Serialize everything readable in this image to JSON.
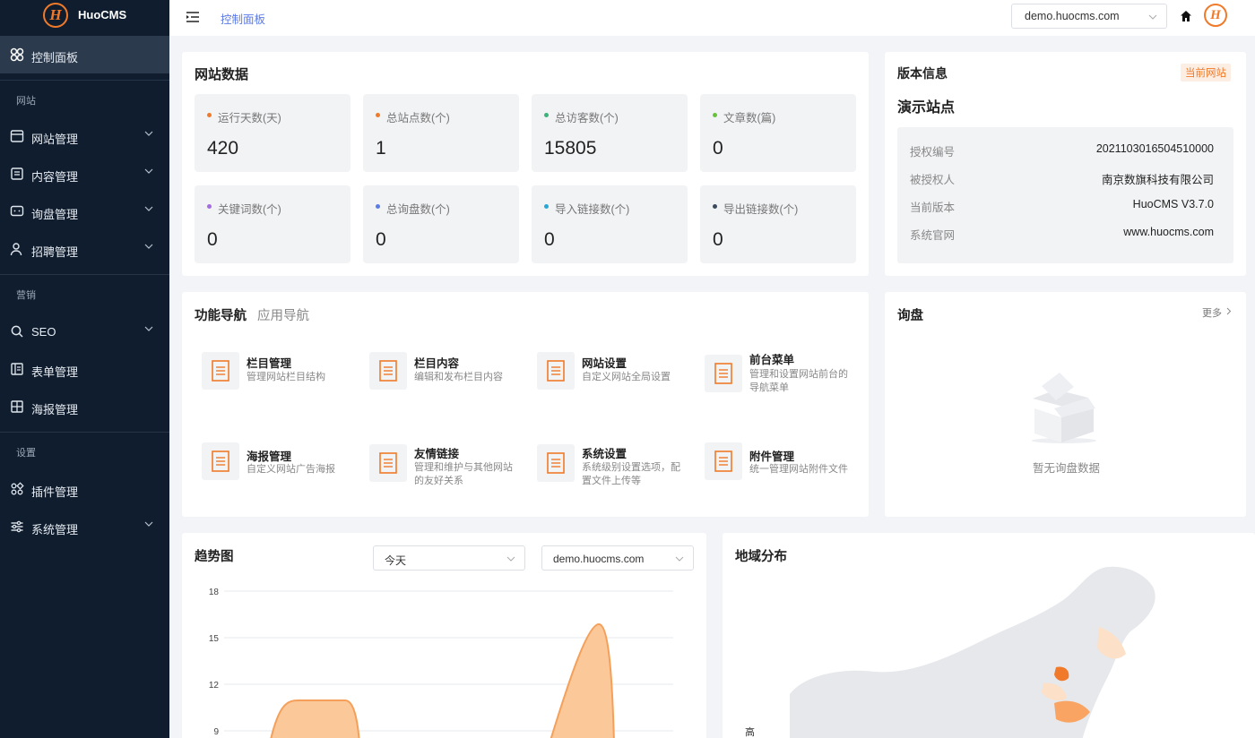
{
  "app": {
    "name": "HuoCMS",
    "logo_letter": "H"
  },
  "sidebar": {
    "active": {
      "label": "控制面板",
      "icon": "dashboard-icon"
    },
    "sections": [
      {
        "title": "网站",
        "items": [
          {
            "label": "网站管理",
            "icon": "window-icon",
            "has_children": true
          },
          {
            "label": "内容管理",
            "icon": "document-icon",
            "has_children": true
          },
          {
            "label": "询盘管理",
            "icon": "message-icon",
            "has_children": true
          },
          {
            "label": "招聘管理",
            "icon": "user-icon",
            "has_children": true
          }
        ]
      },
      {
        "title": "营销",
        "items": [
          {
            "label": "SEO",
            "icon": "search-icon",
            "has_children": true
          },
          {
            "label": "表单管理",
            "icon": "form-icon",
            "has_children": false
          },
          {
            "label": "海报管理",
            "icon": "grid-icon",
            "has_children": false
          }
        ]
      },
      {
        "title": "设置",
        "items": [
          {
            "label": "插件管理",
            "icon": "plugin-icon",
            "has_children": false
          },
          {
            "label": "系统管理",
            "icon": "sliders-icon",
            "has_children": true
          }
        ]
      }
    ]
  },
  "topbar": {
    "breadcrumb": "控制面板",
    "site_select": "demo.huocms.com",
    "home_icon": "home-icon",
    "avatar_icon": "avatar-icon"
  },
  "site_data": {
    "title": "网站数据",
    "stats": [
      {
        "label": "运行天数(天)",
        "value": "420",
        "color": "#f07a2a"
      },
      {
        "label": "总站点数(个)",
        "value": "1",
        "color": "#f07a2a"
      },
      {
        "label": "总访客数(个)",
        "value": "15805",
        "color": "#3bb37a"
      },
      {
        "label": "文章数(篇)",
        "value": "0",
        "color": "#67c23a"
      },
      {
        "label": "关键词数(个)",
        "value": "0",
        "color": "#a56be0"
      },
      {
        "label": "总询盘数(个)",
        "value": "0",
        "color": "#5b7be8"
      },
      {
        "label": "导入链接数(个)",
        "value": "0",
        "color": "#27a6d8"
      },
      {
        "label": "导出链接数(个)",
        "value": "0",
        "color": "#3b4a5c"
      }
    ]
  },
  "version": {
    "title": "版本信息",
    "badge": "当前网站",
    "site_name": "演示站点",
    "rows": [
      {
        "key": "授权编号",
        "value": "2021103016504510000"
      },
      {
        "key": "被授权人",
        "value": "南京数旗科技有限公司"
      },
      {
        "key": "当前版本",
        "value": "HuoCMS V3.7.0"
      },
      {
        "key": "系统官网",
        "value": "www.huocms.com"
      }
    ]
  },
  "functions": {
    "tabs": [
      "功能导航",
      "应用导航"
    ],
    "items": [
      {
        "title": "栏目管理",
        "desc": "管理网站栏目结构"
      },
      {
        "title": "栏目内容",
        "desc": "编辑和发布栏目内容"
      },
      {
        "title": "网站设置",
        "desc": "自定义网站全局设置"
      },
      {
        "title": "前台菜单",
        "desc": "管理和设置网站前台的导航菜单"
      },
      {
        "title": "海报管理",
        "desc": "自定义网站广告海报"
      },
      {
        "title": "友情链接",
        "desc": "管理和维护与其他网站的友好关系"
      },
      {
        "title": "系统设置",
        "desc": "系统级别设置选项，配置文件上传等"
      },
      {
        "title": "附件管理",
        "desc": "统一管理网站附件文件"
      }
    ]
  },
  "inquiry": {
    "title": "询盘",
    "more": "更多",
    "empty": "暂无询盘数据"
  },
  "trend": {
    "title": "趋势图",
    "range_select": "今天",
    "site_select": "demo.huocms.com"
  },
  "chart_data": {
    "type": "area",
    "title": "趋势图",
    "y_ticks": [
      "18",
      "15",
      "12",
      "9"
    ],
    "ylim": [
      9,
      18
    ],
    "series": [
      {
        "values": [
          {
            "x": 0.1,
            "y": 0
          },
          {
            "x": 0.2,
            "y": 11
          },
          {
            "x": 0.4,
            "y": 11
          },
          {
            "x": 0.5,
            "y": 0
          }
        ],
        "color": "#f5a05a"
      },
      {
        "values": [
          {
            "x": 0.75,
            "y": 0
          },
          {
            "x": 0.9,
            "y": 16
          },
          {
            "x": 1.0,
            "y": 0
          }
        ],
        "color": "#f5a05a"
      }
    ]
  },
  "region": {
    "title": "地域分布",
    "legend_high": "高"
  }
}
